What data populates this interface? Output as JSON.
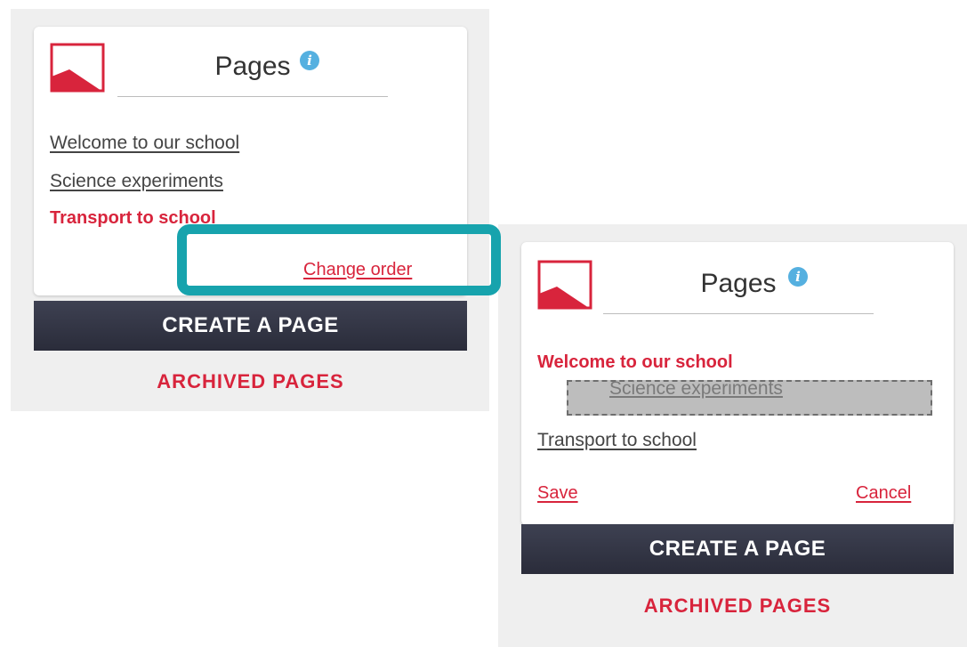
{
  "colors": {
    "accent_red": "#d8243c",
    "highlight_teal": "#17a3ad",
    "info_blue": "#55b0e0",
    "bar_dark": "#2f3140"
  },
  "panel_before": {
    "title": "Pages",
    "info_icon": "info-icon",
    "pages": [
      {
        "label": "Welcome to our school",
        "state": "link"
      },
      {
        "label": "Science experiments",
        "state": "link"
      },
      {
        "label": "Transport to school",
        "state": "current"
      }
    ],
    "change_order_label": "Change order",
    "create_label": "CREATE A PAGE",
    "archived_label": "ARCHIVED PAGES"
  },
  "panel_after": {
    "title": "Pages",
    "info_icon": "info-icon",
    "pages": [
      {
        "label": "Welcome to our school",
        "state": "current"
      },
      {
        "label": "Science experiments",
        "state": "dragging"
      },
      {
        "label": "Transport to school",
        "state": "link"
      }
    ],
    "save_label": "Save",
    "cancel_label": "Cancel",
    "create_label": "CREATE A PAGE",
    "archived_label": "ARCHIVED PAGES"
  }
}
